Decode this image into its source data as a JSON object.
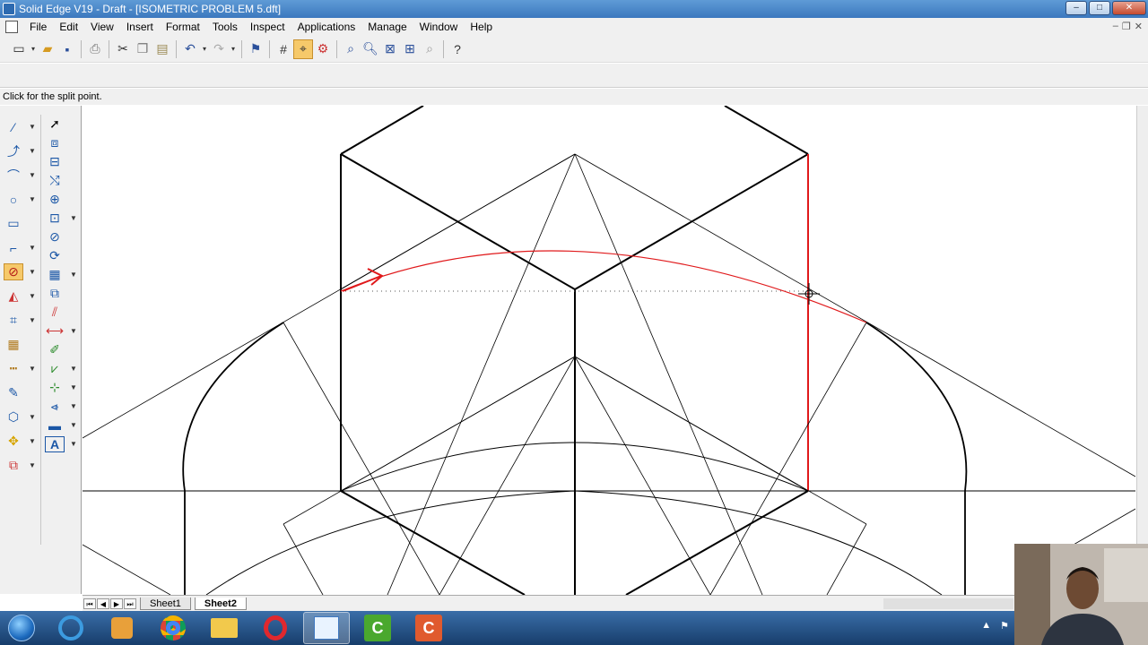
{
  "window": {
    "title": "Solid Edge V19 - Draft - [ISOMETRIC PROBLEM 5.dft]",
    "min": "–",
    "max": "□",
    "close": "✕"
  },
  "menubar": {
    "items": [
      "File",
      "Edit",
      "View",
      "Insert",
      "Format",
      "Tools",
      "Inspect",
      "Applications",
      "Manage",
      "Window",
      "Help"
    ],
    "mdi": {
      "min": "–",
      "restore": "❐",
      "close": "✕"
    }
  },
  "toolbar": {
    "icons": [
      "new-icon",
      "open-icon",
      "save-icon",
      "print-icon",
      "cut-icon",
      "copy-icon",
      "paste-icon",
      "undo-icon",
      "redo-icon",
      "flag-icon",
      "grid-icon",
      "intellisketch-icon",
      "relationship-icon",
      "zoom-area-icon",
      "zoom-icon",
      "fit-icon",
      "pan-icon",
      "zoom-tool-icon",
      "whats-this-icon"
    ],
    "active": "intellisketch-icon"
  },
  "prompt": {
    "text": "Click for the split point."
  },
  "left_tools": {
    "col1": [
      "line-icon",
      "curve-icon",
      "arc-icon",
      "circle-icon",
      "rectangle-icon",
      "fillet-icon",
      "split-icon",
      "trim-icon",
      "pattern-icon",
      "fill-icon",
      "dimension-icon",
      "smart-dimension-icon",
      "view-icon",
      "move-icon",
      "annotation-icon"
    ],
    "col2": [
      "select-icon",
      "tool-a-icon",
      "tool-b-icon",
      "tool-c-icon",
      "tool-d-icon",
      "tool-e-icon",
      "tool-f-icon",
      "tool-g-icon",
      "tool-h-icon",
      "tool-i-icon",
      "tool-j-icon",
      "tool-k-icon",
      "tool-l-icon",
      "tool-m-icon",
      "tool-n-icon",
      "tool-o-icon",
      "text-icon"
    ],
    "active": "split-icon"
  },
  "sheets": {
    "tabs": [
      "Sheet1",
      "Sheet2"
    ],
    "active": "Sheet2"
  },
  "colors": {
    "highlight": "#e0191b",
    "titlebar": "#3b78be",
    "toolbar_bg": "#f0f0f0"
  }
}
